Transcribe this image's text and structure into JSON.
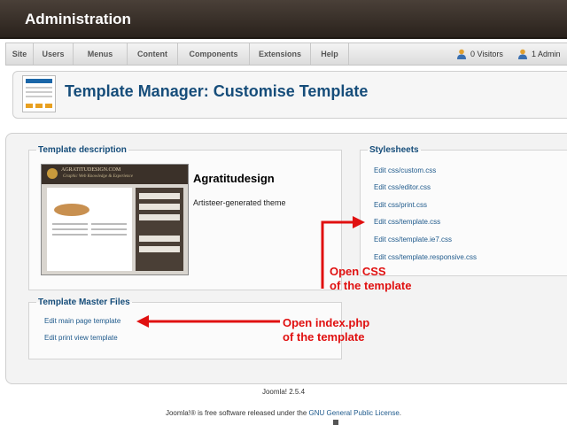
{
  "header": {
    "title": "Administration"
  },
  "menu": {
    "items": [
      "Site",
      "Users",
      "Menus",
      "Content",
      "Components",
      "Extensions",
      "Help"
    ],
    "visitors": "0 Visitors",
    "admin": "1 Admin"
  },
  "toolbar": {
    "page_title": "Template Manager: Customise Template"
  },
  "template": {
    "section_title": "Template description",
    "name": "Agratitudesign",
    "description": "Artisteer-generated theme",
    "thumb_logo_text": "AGRATITUDESIGN.COM",
    "thumb_tagline": "Graphic Web Knowledge & Experience"
  },
  "stylesheets": {
    "section_title": "Stylesheets",
    "links": [
      "Edit css/custom.css",
      "Edit css/editor.css",
      "Edit css/print.css",
      "Edit css/template.css",
      "Edit css/template.ie7.css",
      "Edit css/template.responsive.css"
    ]
  },
  "master_files": {
    "section_title": "Template Master Files",
    "links": [
      "Edit main page template",
      "Edit print view template"
    ]
  },
  "annotations": {
    "css_line1": "Open CSS",
    "css_line2": "of the template",
    "index_line1": "Open index.php",
    "index_line2": "of the template"
  },
  "footer": {
    "version": "Joomla! 2.5.4",
    "license_prefix": "Joomla!® is free software released under the ",
    "license_link": "GNU General Public License",
    "license_suffix": "."
  },
  "colors": {
    "header_bg": "#2f2620",
    "title_blue": "#164d7a",
    "link_blue": "#1f5a8c",
    "annotation_red": "#e01010"
  }
}
